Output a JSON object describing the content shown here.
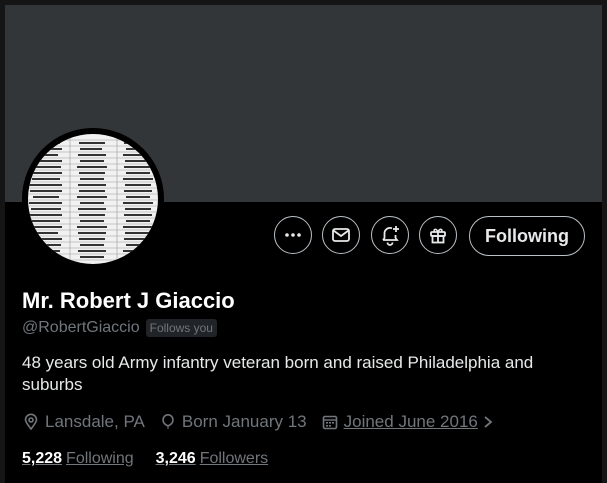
{
  "profile": {
    "display_name": "Mr. Robert J Giaccio",
    "handle": "@RobertGiaccio",
    "follows_you_badge": "Follows you",
    "bio": "48 years old Army infantry veteran born and raised Philadelphia and suburbs",
    "location": "Lansdale, PA",
    "birthday": "Born January 13",
    "joined": "Joined June 2016",
    "following_count": "5,228",
    "following_label": "Following",
    "followers_count": "3,246",
    "followers_label": "Followers"
  },
  "actions": {
    "following_button": "Following",
    "more_icon": "more-icon",
    "message_icon": "envelope-icon",
    "notify_icon": "bell-plus-icon",
    "gift_icon": "gift-icon"
  },
  "colors": {
    "background": "#000000",
    "banner": "#333639",
    "secondary_text": "#71767b",
    "primary_text": "#e7e9ea"
  }
}
